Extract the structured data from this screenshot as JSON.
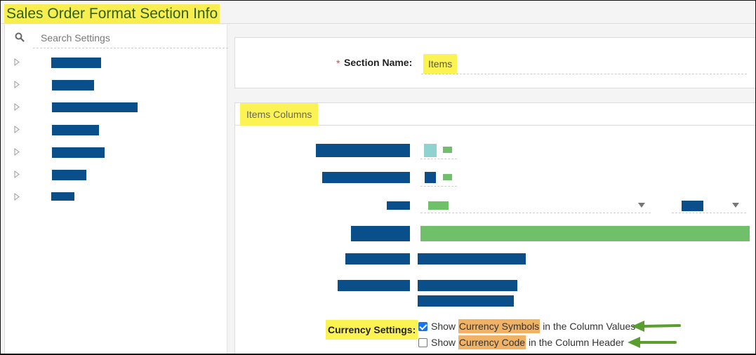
{
  "page": {
    "title": "Sales Order Format Section Info"
  },
  "sidebar": {
    "search_placeholder": "Search Settings",
    "items": [
      {
        "label": "[redacted]",
        "collapsed": true
      },
      {
        "label": "[redacted]",
        "collapsed": true
      },
      {
        "label": "[redacted]",
        "collapsed": true
      },
      {
        "label": "[redacted]",
        "collapsed": true
      },
      {
        "label": "[redacted]",
        "collapsed": true
      },
      {
        "label": "[redacted]",
        "collapsed": true
      },
      {
        "label": "[redacted]",
        "collapsed": true
      }
    ]
  },
  "section": {
    "required_marker": "*",
    "name_label": "Section Name:",
    "name_value": "Items"
  },
  "items_columns": {
    "title": "Items Columns",
    "rows": [
      {
        "label": "[redacted]",
        "value": "[redacted color swatch]"
      },
      {
        "label": "[redacted]",
        "value": "[redacted color swatch]"
      },
      {
        "label": "[redacted]",
        "value": "[redacted dropdown]",
        "secondary": "[redacted dropdown]"
      },
      {
        "label": "[redacted]",
        "value": "[redacted]"
      },
      {
        "label": "[redacted]",
        "value": "[redacted]"
      },
      {
        "label": "[redacted]",
        "value": "[redacted]"
      }
    ],
    "currency": {
      "label": "Currency Settings:",
      "options": [
        {
          "prefix": "Show",
          "highlight": "Currency Symbols",
          "suffix": "in the Column Values",
          "checked": true
        },
        {
          "prefix": "Show",
          "highlight": "Currency Code",
          "suffix": "in the Column Header",
          "checked": false
        }
      ]
    }
  },
  "colors": {
    "redaction_blue": "#0a4f8a",
    "redaction_green": "#70c06a",
    "highlight_yellow": "#fbf253",
    "highlight_orange": "#f0b366",
    "annotation_arrow": "#5a9e2f"
  }
}
